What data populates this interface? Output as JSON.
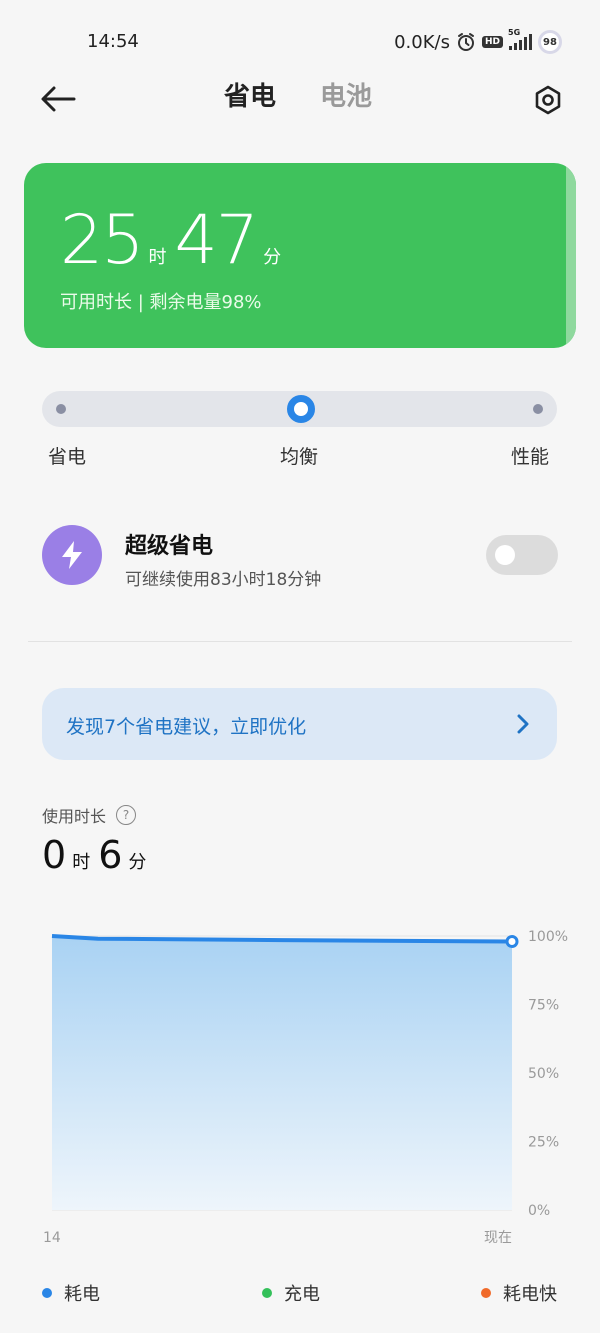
{
  "status_bar": {
    "time": "14:54",
    "net_speed": "0.0K/s",
    "hd_label": "HD",
    "signal_label": "5G",
    "battery_level": "98",
    "icons": [
      "alarm-icon",
      "hd-icon",
      "signal-5g-icon",
      "battery-icon"
    ]
  },
  "header": {
    "tab_power_save": "省电",
    "tab_battery": "电池",
    "active_tab": "省电",
    "back_icon": "back-arrow-icon",
    "settings_icon": "settings-icon"
  },
  "battery_card": {
    "hours": "25",
    "hours_unit": "时",
    "minutes": "47",
    "minutes_unit": "分",
    "subtitle": "可用时长 | 剩余电量98%",
    "color": "#3fc25c"
  },
  "mode_selector": {
    "options": [
      "省电",
      "均衡",
      "性能"
    ],
    "selected": "均衡",
    "accent": "#2a86e6"
  },
  "super_saver": {
    "title": "超级省电",
    "subtitle": "可继续使用83小时18分钟",
    "enabled": false,
    "icon": "lightning-icon",
    "icon_color": "#9a7fe6"
  },
  "suggestion": {
    "text": "发现7个省电建议，立即优化",
    "icon": "chevron-right-icon"
  },
  "usage": {
    "label": "使用时长",
    "hours": "0",
    "hours_unit": "时",
    "minutes": "6",
    "minutes_unit": "分"
  },
  "chart_data": {
    "type": "area",
    "x": [
      "14",
      "现在"
    ],
    "points": [
      [
        0,
        100
      ],
      [
        0.1,
        99
      ],
      [
        0.5,
        98.5
      ],
      [
        1,
        98
      ]
    ],
    "y_ticks": [
      "100%",
      "75%",
      "50%",
      "25%",
      "0%"
    ],
    "ylim": [
      0,
      100
    ],
    "x_tick_labels": [
      "14",
      "现在"
    ],
    "line_color": "#2a86e6",
    "grid": true
  },
  "legend": [
    {
      "label": "耗电",
      "color": "#2a86e6"
    },
    {
      "label": "充电",
      "color": "#34c05a"
    },
    {
      "label": "耗电快",
      "color": "#f06a2a"
    }
  ]
}
